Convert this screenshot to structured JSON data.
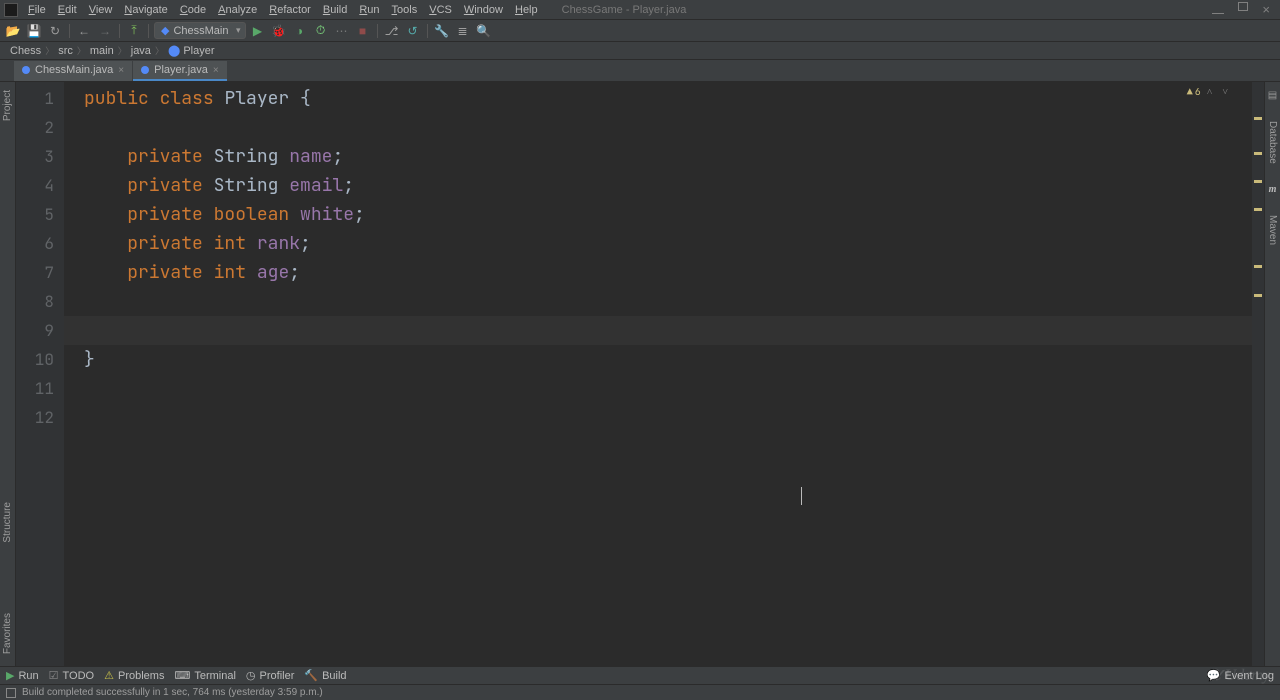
{
  "app": {
    "title": "ChessGame - Player.java"
  },
  "menu": [
    "File",
    "Edit",
    "View",
    "Navigate",
    "Code",
    "Analyze",
    "Refactor",
    "Build",
    "Run",
    "Tools",
    "VCS",
    "Window",
    "Help"
  ],
  "run_config": "ChessMain",
  "breadcrumb": [
    "Chess",
    "src",
    "main",
    "java",
    "Player"
  ],
  "tabs": [
    {
      "name": "ChessMain.java",
      "active": false
    },
    {
      "name": "Player.java",
      "active": true
    }
  ],
  "inspection": {
    "warnings_label": "6"
  },
  "code": {
    "lines": [
      {
        "n": 1,
        "tokens": [
          [
            "kw",
            "public"
          ],
          [
            "plain",
            " "
          ],
          [
            "kw",
            "class"
          ],
          [
            "plain",
            " "
          ],
          [
            "cls",
            "Player"
          ],
          [
            "plain",
            " {"
          ]
        ]
      },
      {
        "n": 2,
        "tokens": []
      },
      {
        "n": 3,
        "tokens": [
          [
            "plain",
            "    "
          ],
          [
            "kw",
            "private"
          ],
          [
            "plain",
            " "
          ],
          [
            "type",
            "String"
          ],
          [
            "plain",
            " "
          ],
          [
            "ident",
            "name"
          ],
          [
            "plain",
            ";"
          ]
        ]
      },
      {
        "n": 4,
        "tokens": [
          [
            "plain",
            "    "
          ],
          [
            "kw",
            "private"
          ],
          [
            "plain",
            " "
          ],
          [
            "type",
            "String"
          ],
          [
            "plain",
            " "
          ],
          [
            "ident",
            "email"
          ],
          [
            "plain",
            ";"
          ]
        ]
      },
      {
        "n": 5,
        "tokens": [
          [
            "plain",
            "    "
          ],
          [
            "kw",
            "private"
          ],
          [
            "plain",
            " "
          ],
          [
            "kw",
            "boolean"
          ],
          [
            "plain",
            " "
          ],
          [
            "ident",
            "white"
          ],
          [
            "plain",
            ";"
          ]
        ]
      },
      {
        "n": 6,
        "tokens": [
          [
            "plain",
            "    "
          ],
          [
            "kw",
            "private"
          ],
          [
            "plain",
            " "
          ],
          [
            "kw",
            "int"
          ],
          [
            "plain",
            " "
          ],
          [
            "ident",
            "rank"
          ],
          [
            "plain",
            ";"
          ]
        ]
      },
      {
        "n": 7,
        "tokens": [
          [
            "plain",
            "    "
          ],
          [
            "kw",
            "private"
          ],
          [
            "plain",
            " "
          ],
          [
            "kw",
            "int"
          ],
          [
            "plain",
            " "
          ],
          [
            "ident",
            "age"
          ],
          [
            "plain",
            ";"
          ]
        ]
      },
      {
        "n": 8,
        "tokens": []
      },
      {
        "n": 9,
        "tokens": [],
        "highlight": true
      },
      {
        "n": 10,
        "tokens": []
      },
      {
        "n": 11,
        "tokens": [
          [
            "plain",
            "}"
          ]
        ]
      },
      {
        "n": 12,
        "tokens": []
      }
    ]
  },
  "left_rail": [
    "Project",
    "Structure",
    "Favorites"
  ],
  "right_rail": {
    "database": "Database",
    "maven": "Maven",
    "maven_glyph": "m"
  },
  "bottom": {
    "run": "Run",
    "todo": "TODO",
    "problems": "Problems",
    "terminal": "Terminal",
    "profiler": "Profiler",
    "build": "Build",
    "event_log": "Event Log"
  },
  "status": "Build completed successfully in 1 sec, 764 ms (yesterday 3:59 p.m.)",
  "markers_y": [
    35,
    70,
    98,
    126,
    183,
    212
  ]
}
